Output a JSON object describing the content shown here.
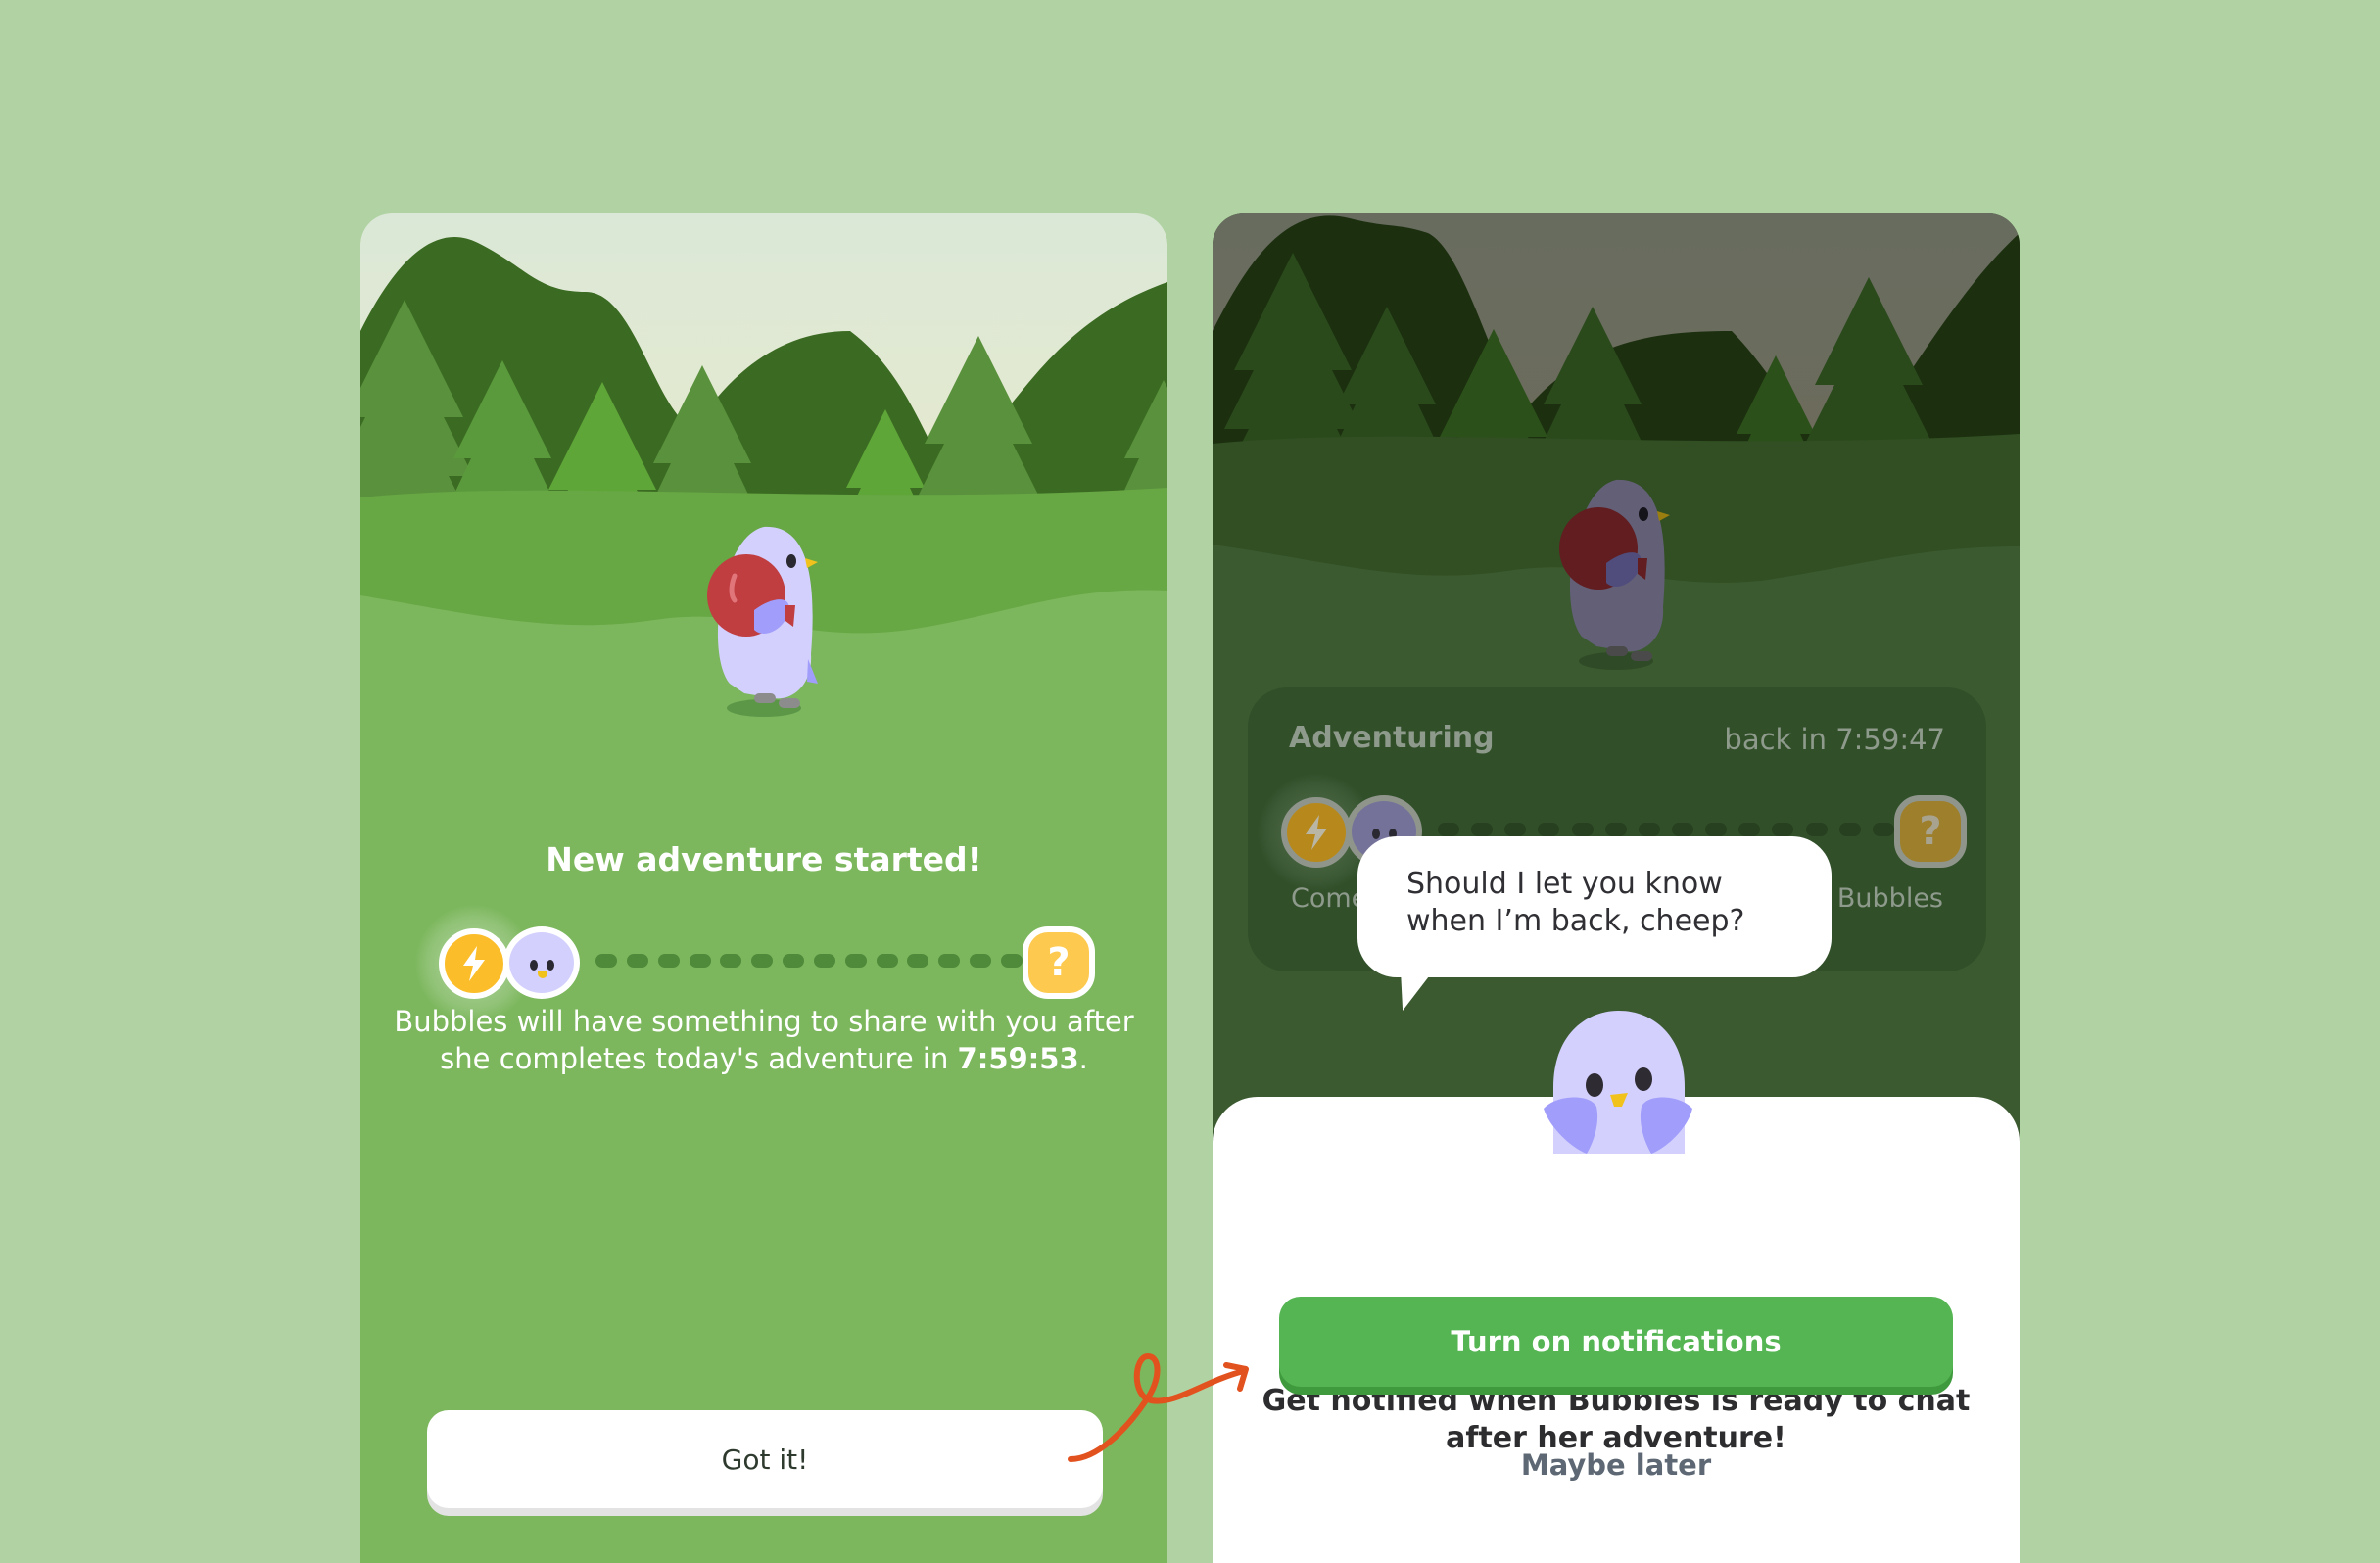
{
  "colors": {
    "background": "#b1d3a3",
    "grass_left": "#7cb75d",
    "accent_green": "#54b552",
    "arrow_orange": "#e2521f",
    "bird_purple": "#d3d0fd",
    "coin_yellow": "#fbbe2a"
  },
  "left_screen": {
    "title": "New adventure started!",
    "progress": {
      "start_icon": "lightning-bolt-icon",
      "avatar": "bubbles-bird-avatar",
      "end_icon": "question-mark-icon",
      "end_icon_glyph": "?",
      "steps_total": 14,
      "steps_completed": 0
    },
    "description_prefix": "Bubbles will have something to share with you after she completes today's adventure in ",
    "countdown": "7:59:53",
    "description_suffix": ".",
    "got_it_label": "Got it!"
  },
  "right_screen": {
    "status_card": {
      "title": "Adventuring",
      "time_label": "back in 7:59:47",
      "caption_left_visible": "Come",
      "caption_right_visible": "Bubbles",
      "end_icon_glyph": "?"
    },
    "speech_bubble": "Should I let you know when I’m back, cheep?",
    "sheet": {
      "title": "Get notified when Bubbles is ready to chat after her adventure!",
      "primary_button": "Turn on notifications",
      "secondary_button": "Maybe later"
    }
  }
}
